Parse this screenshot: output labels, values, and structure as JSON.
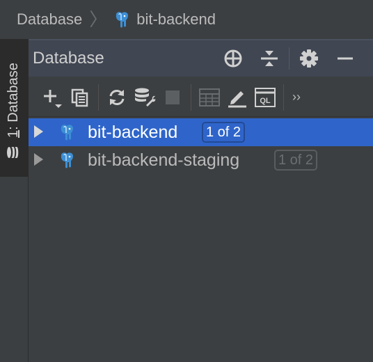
{
  "breadcrumb": {
    "root": "Database",
    "separator": "〉",
    "current": "bit-backend",
    "current_icon": "postgresql-elephant-icon"
  },
  "side_tab": {
    "number": "1",
    "label": ": Database",
    "icon": "database-cylinder-icon"
  },
  "panel": {
    "title": "Database",
    "header_icons": [
      "crosshair-target-icon",
      "collapse-all-icon",
      "gear-icon",
      "minimize-icon"
    ]
  },
  "toolbar": {
    "icons": [
      "add-icon",
      "copy-properties-icon",
      "refresh-icon",
      "database-settings-icon",
      "stop-icon",
      "table-view-icon",
      "edit-pencil-icon",
      "console-ql-icon",
      "more-chevrons-icon"
    ],
    "console_label": "QL",
    "more_label": "››"
  },
  "tree": {
    "items": [
      {
        "label": "bit-backend",
        "badge": "1 of 2",
        "selected": true,
        "icon": "postgresql-elephant-icon"
      },
      {
        "label": "bit-backend-staging",
        "badge": "1 of 2",
        "selected": false,
        "icon": "postgresql-elephant-icon"
      }
    ]
  },
  "colors": {
    "background": "#3c3f41",
    "header_background": "#404652",
    "selection": "#2f65ca",
    "postgres_blue": "#3d8fd4"
  }
}
